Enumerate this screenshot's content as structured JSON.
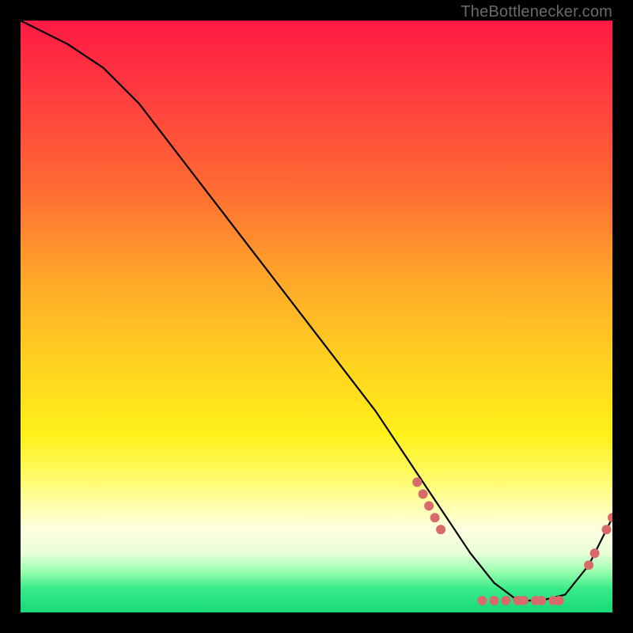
{
  "attribution": "TheBottlenecker.com",
  "chart_data": {
    "type": "line",
    "title": "",
    "xlabel": "",
    "ylabel": "",
    "xlim": [
      0,
      100
    ],
    "ylim": [
      0,
      100
    ],
    "series": [
      {
        "name": "curve",
        "x": [
          0,
          8,
          14,
          20,
          30,
          40,
          50,
          60,
          68,
          72,
          76,
          80,
          84,
          88,
          92,
          96,
          100
        ],
        "values": [
          100,
          96,
          92,
          86,
          73,
          60,
          47,
          34,
          22,
          16,
          10,
          5,
          2,
          2,
          3,
          8,
          16
        ]
      }
    ],
    "markers": [
      {
        "x": 67,
        "y": 22
      },
      {
        "x": 68,
        "y": 20
      },
      {
        "x": 69,
        "y": 18
      },
      {
        "x": 70,
        "y": 16
      },
      {
        "x": 71,
        "y": 14
      },
      {
        "x": 78,
        "y": 2
      },
      {
        "x": 80,
        "y": 2
      },
      {
        "x": 82,
        "y": 2
      },
      {
        "x": 84,
        "y": 2
      },
      {
        "x": 85,
        "y": 2
      },
      {
        "x": 87,
        "y": 2
      },
      {
        "x": 88,
        "y": 2
      },
      {
        "x": 90,
        "y": 2
      },
      {
        "x": 91,
        "y": 2
      },
      {
        "x": 96,
        "y": 8
      },
      {
        "x": 97,
        "y": 10
      },
      {
        "x": 99,
        "y": 14
      },
      {
        "x": 100,
        "y": 16
      }
    ],
    "marker_color": "#d96a6a",
    "line_color": "#000000"
  }
}
